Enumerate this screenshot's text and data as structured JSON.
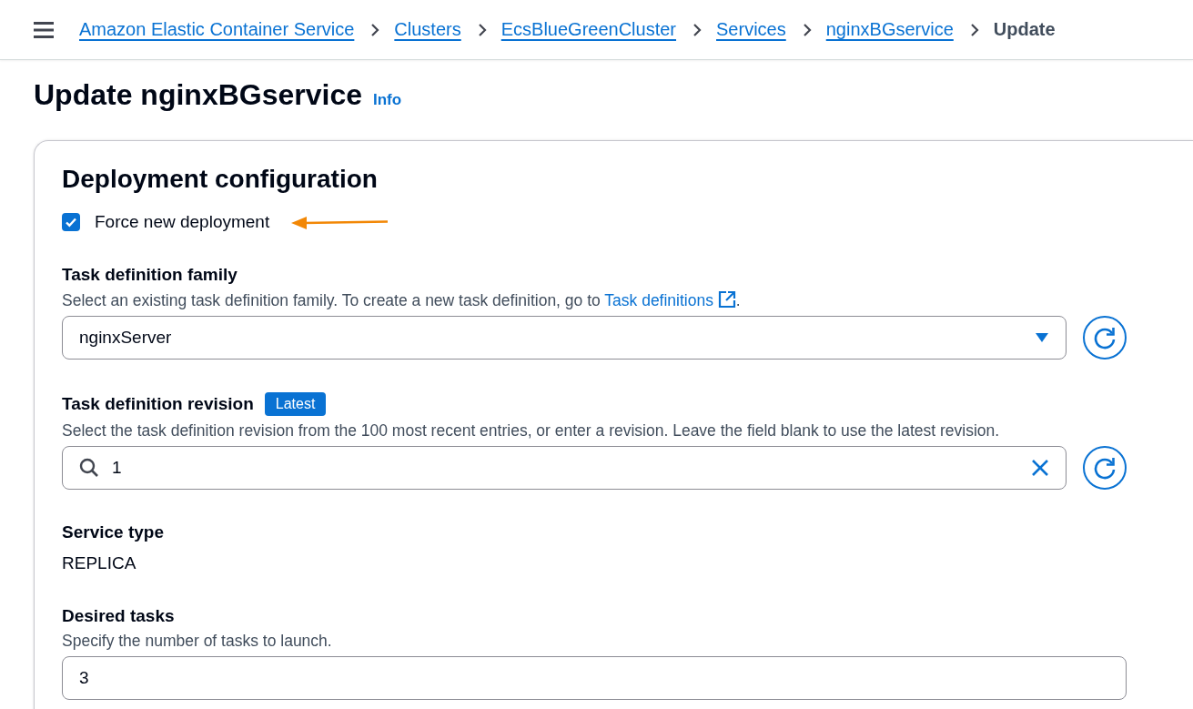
{
  "breadcrumbs": [
    {
      "label": "Amazon Elastic Container Service",
      "kind": "link"
    },
    {
      "label": "Clusters",
      "kind": "link"
    },
    {
      "label": "EcsBlueGreenCluster",
      "kind": "link"
    },
    {
      "label": "Services",
      "kind": "link"
    },
    {
      "label": "nginxBGservice",
      "kind": "link"
    },
    {
      "label": "Update",
      "kind": "current"
    }
  ],
  "page": {
    "title": "Update nginxBGservice",
    "info_link": "Info"
  },
  "section": {
    "heading": "Deployment configuration",
    "checkbox": {
      "label": "Force new deployment",
      "checked": true
    },
    "fields": [
      {
        "kind": "select",
        "label": "Task definition family",
        "description": "Select an existing task definition family. To create a new task definition, go to ",
        "link": "Task definitions",
        "description_end": ".",
        "value": "nginxServer"
      },
      {
        "kind": "search",
        "label": "Task definition revision",
        "badge": "Latest",
        "description": "Select the task definition revision from the 100 most recent entries, or enter a revision. Leave the field blank to use the latest revision.",
        "value": "1"
      },
      {
        "kind": "static",
        "label": "Service type",
        "value": "REPLICA"
      },
      {
        "kind": "input",
        "label": "Desired tasks",
        "description": "Specify the number of tasks to launch.",
        "value": "3"
      }
    ]
  }
}
